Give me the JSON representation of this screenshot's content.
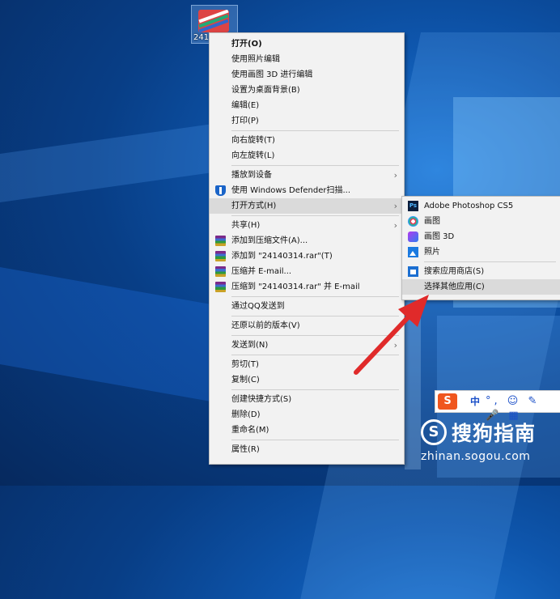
{
  "desktop_icon": {
    "label": "241"
  },
  "main_menu": {
    "items": [
      {
        "label": "打开(O)"
      },
      {
        "label": "使用照片编辑"
      },
      {
        "label": "使用画图 3D 进行编辑"
      },
      {
        "label": "设置为桌面背景(B)"
      },
      {
        "label": "编辑(E)"
      },
      {
        "label": "打印(P)"
      },
      {
        "label": "向右旋转(T)"
      },
      {
        "label": "向左旋转(L)"
      },
      {
        "label": "播放到设备"
      },
      {
        "label": "使用 Windows Defender扫描..."
      },
      {
        "label": "打开方式(H)"
      },
      {
        "label": "共享(H)"
      },
      {
        "label": "添加到压缩文件(A)..."
      },
      {
        "label": "添加到 \"24140314.rar\"(T)"
      },
      {
        "label": "压缩并 E-mail..."
      },
      {
        "label": "压缩到 \"24140314.rar\" 并 E-mail"
      },
      {
        "label": "通过QQ发送到"
      },
      {
        "label": "还原以前的版本(V)"
      },
      {
        "label": "发送到(N)"
      },
      {
        "label": "剪切(T)"
      },
      {
        "label": "复制(C)"
      },
      {
        "label": "创建快捷方式(S)"
      },
      {
        "label": "删除(D)"
      },
      {
        "label": "重命名(M)"
      },
      {
        "label": "属性(R)"
      }
    ]
  },
  "open_with_menu": {
    "items": [
      {
        "label": "Adobe Photoshop CS5",
        "icon": "photoshop-icon"
      },
      {
        "label": "画图",
        "icon": "paint-icon"
      },
      {
        "label": "画图 3D",
        "icon": "paint-3d-icon"
      },
      {
        "label": "照片",
        "icon": "photos-icon"
      },
      {
        "label": "搜索应用商店(S)",
        "icon": "store-icon"
      },
      {
        "label": "选择其他应用(C)"
      }
    ]
  },
  "ime_toolbar": {
    "logo": "S",
    "mode": "中"
  },
  "watermark": {
    "logo": "S",
    "brand": "搜狗指南",
    "url": "zhinan.sogou.com"
  },
  "colors": {
    "menu_bg": "#f2f2f2",
    "highlight": "#dadada",
    "arrow_red": "#e02a2a",
    "ime_orange": "#f0561e"
  }
}
